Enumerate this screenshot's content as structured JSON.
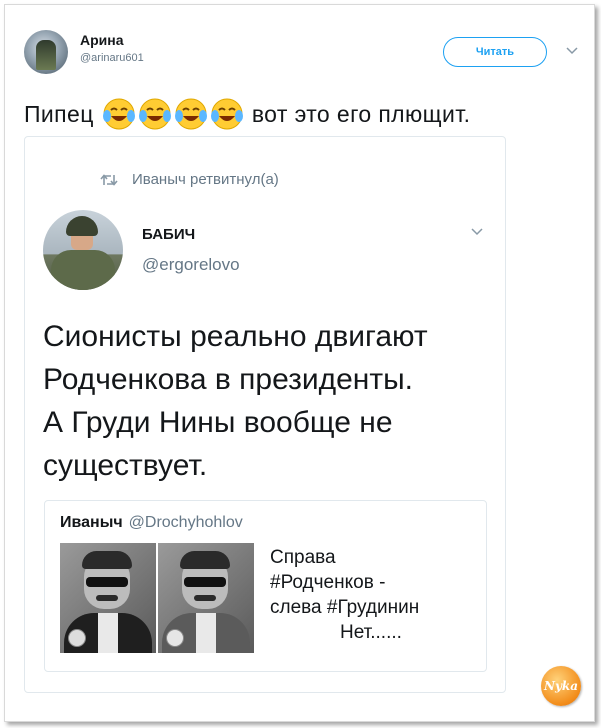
{
  "outer_tweet": {
    "name": "Арина",
    "handle": "@arinaru601",
    "follow_label": "Читать",
    "text_before": "Пипец",
    "emoji": [
      "face-with-tears-of-joy",
      "face-with-tears-of-joy",
      "face-with-tears-of-joy",
      "face-with-tears-of-joy"
    ],
    "text_after": "вот это его плющит."
  },
  "retweet": {
    "label": "Иваныч ретвитнул(а)",
    "icon": "retweet-icon"
  },
  "inner_tweet": {
    "name": "БАБИЧ",
    "handle": "@ergorelovo",
    "text_lines": [
      "Сионисты реально двигают",
      "Родченкова в президенты.",
      "А Груди Нины вообще не",
      "существует."
    ]
  },
  "quoted_tweet": {
    "name": "Иваныч",
    "handle": "@Drochyhohlov",
    "text_lines": [
      "Справа",
      "#Родченков -",
      "слева #Грудинин",
      "Нет......"
    ]
  },
  "watermark": {
    "text": "Nyka"
  },
  "colors": {
    "accent": "#1da1f2",
    "muted": "#657786",
    "text": "#14171a",
    "border": "#e1e8ed"
  }
}
